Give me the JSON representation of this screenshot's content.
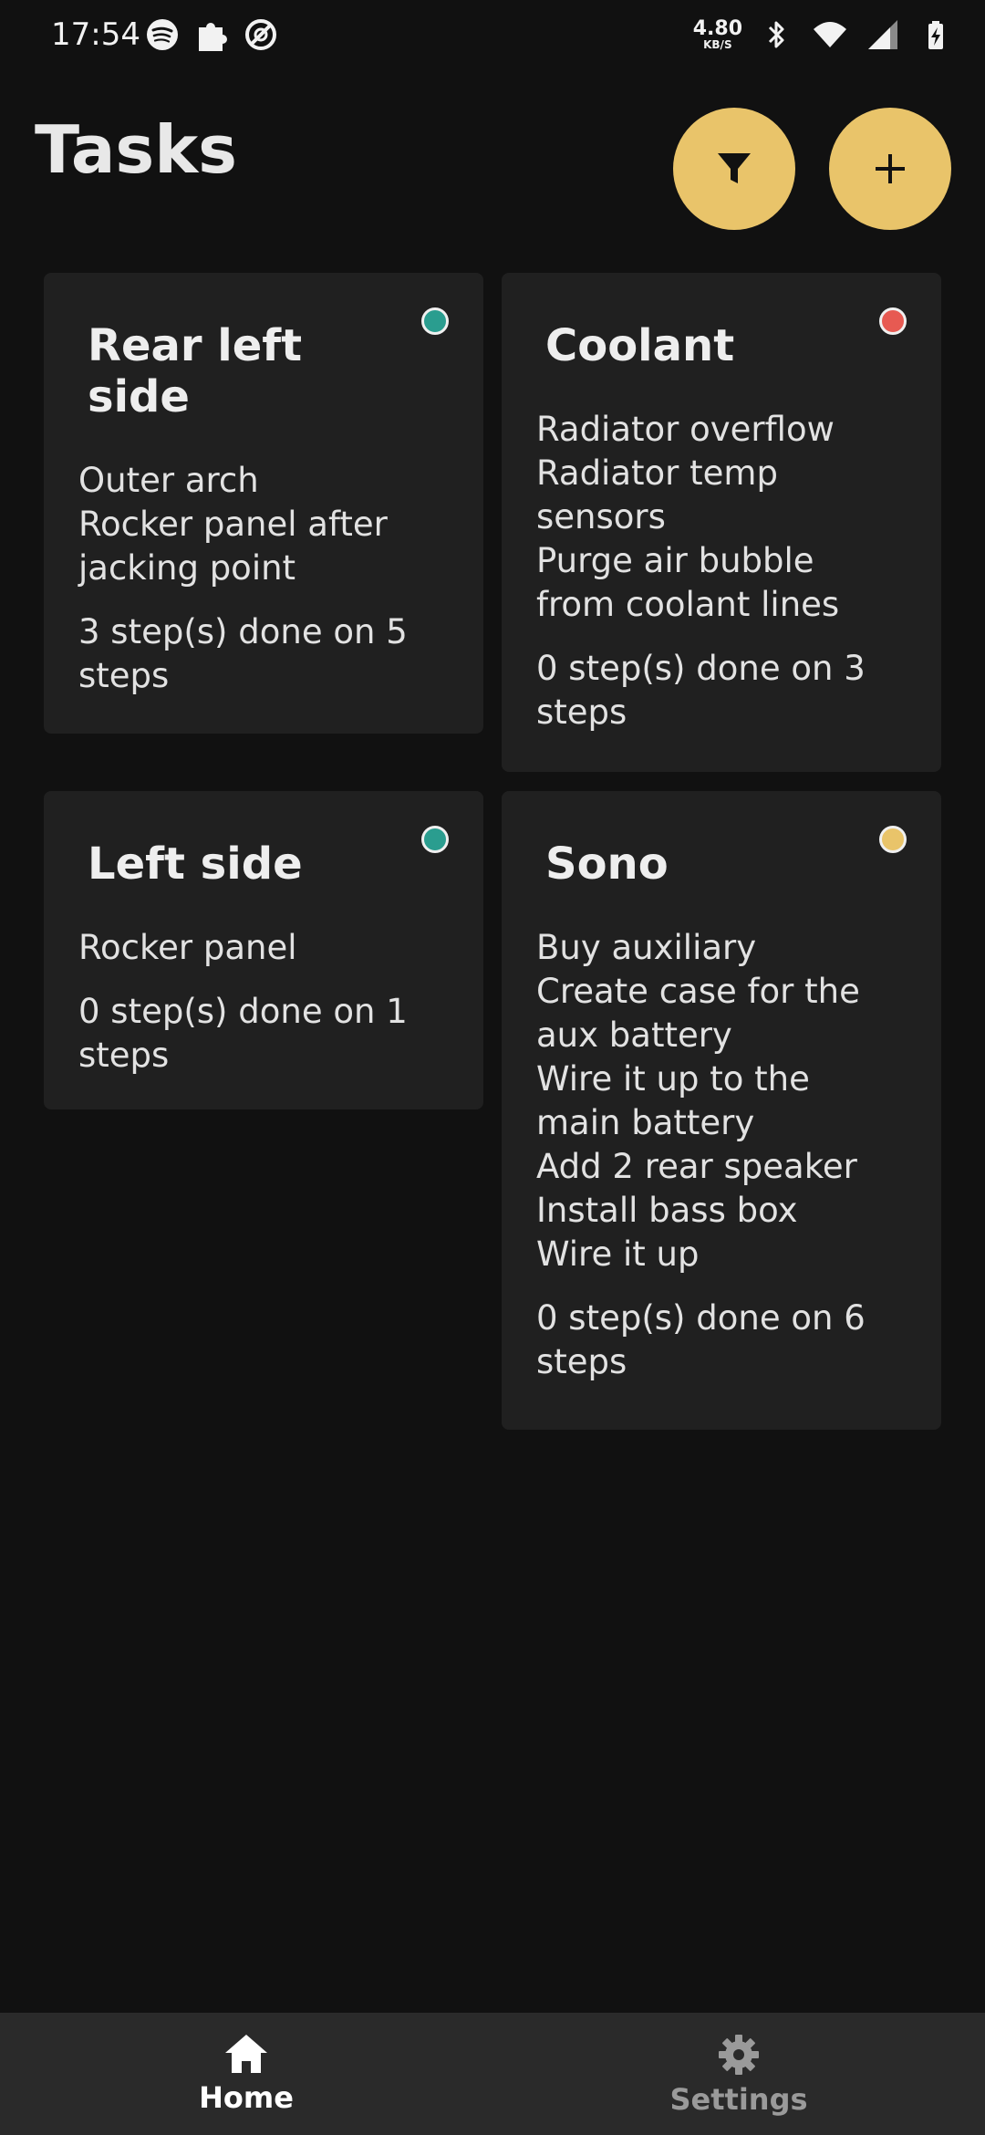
{
  "status_bar": {
    "time": "17:54",
    "left_icons": [
      "spotify-icon",
      "puzzle-icon",
      "dnd-icon"
    ],
    "net_speed_value": "4.80",
    "net_speed_unit": "KB/S",
    "right_icons": [
      "bluetooth-icon",
      "wifi-icon",
      "cellular-signal-icon",
      "battery-charging-icon"
    ]
  },
  "header": {
    "title": "Tasks",
    "filter_icon": "filter-icon",
    "add_icon": "plus-icon"
  },
  "colors": {
    "accent": "#e9c46a",
    "background": "#111111",
    "card": "#202020",
    "nav": "#2a2a2a",
    "status_teal": "#2a9d8f",
    "status_red": "#e75a52",
    "status_yellow": "#e9c46a"
  },
  "tasks": [
    {
      "title": "Rear left side",
      "steps": [
        "Outer arch",
        "Rocker panel after jacking point"
      ],
      "progress": "3 step(s) done on 5 steps",
      "status_color": "#2a9d8f"
    },
    {
      "title": "Coolant",
      "steps": [
        "Radiator overflow",
        "Radiator temp sensors",
        "Purge air bubble from coolant lines"
      ],
      "progress": "0 step(s) done on 3 steps",
      "status_color": "#e75a52"
    },
    {
      "title": "Left side",
      "steps": [
        "Rocker panel"
      ],
      "progress": "0 step(s) done on 1 steps",
      "status_color": "#2a9d8f"
    },
    {
      "title": "Sono",
      "steps": [
        "Buy auxiliary",
        "Create case for the aux battery",
        "Wire it up to the main battery",
        "Add 2 rear speaker",
        "Install bass box",
        "Wire it up"
      ],
      "progress": "0 step(s) done on 6 steps",
      "status_color": "#e9c46a"
    }
  ],
  "bottom_nav": {
    "home": {
      "label": "Home",
      "icon": "home-icon",
      "active": true
    },
    "settings": {
      "label": "Settings",
      "icon": "gear-icon",
      "active": false
    }
  }
}
